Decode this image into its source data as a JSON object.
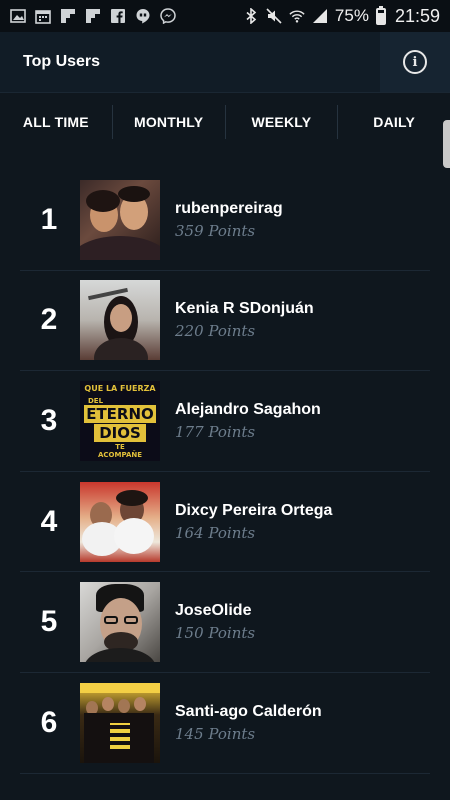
{
  "status_bar": {
    "battery": "75%",
    "time": "21:59",
    "left_icons": [
      "image-icon",
      "calendar-icon",
      "flipboard-icon",
      "flipboard-icon",
      "facebook-icon",
      "hangouts-icon",
      "messenger-icon"
    ],
    "right_icons": [
      "bluetooth-icon",
      "mute-icon",
      "wifi-icon",
      "signal-icon",
      "battery-icon"
    ]
  },
  "header": {
    "title": "Top Users",
    "info_icon": "info-icon"
  },
  "tabs": [
    {
      "label": "ALL TIME"
    },
    {
      "label": "MONTHLY"
    },
    {
      "label": "WEEKLY"
    },
    {
      "label": "DAILY"
    }
  ],
  "users": [
    {
      "rank": "1",
      "name": "rubenpereirag",
      "points": "359 Points"
    },
    {
      "rank": "2",
      "name": "Kenia R SDonjuán",
      "points": "220 Points"
    },
    {
      "rank": "3",
      "name": "Alejandro Sagahon",
      "points": "177 Points"
    },
    {
      "rank": "4",
      "name": "Dixcy Pereira Ortega",
      "points": "164 Points"
    },
    {
      "rank": "5",
      "name": "JoseOlide",
      "points": "150 Points"
    },
    {
      "rank": "6",
      "name": "Santi-ago Calderón",
      "points": "145 Points"
    }
  ],
  "avatar_3_text": {
    "line1": "QUE LA FUERZA",
    "line2": "DEL",
    "line3": "ETERNO",
    "line4": "DIOS",
    "line5": "TE",
    "line6": "ACOMPAÑE"
  },
  "colors": {
    "background": "#0f171e",
    "header": "#111c26",
    "points_text": "#6d7d8c",
    "divider": "#1c2834"
  }
}
